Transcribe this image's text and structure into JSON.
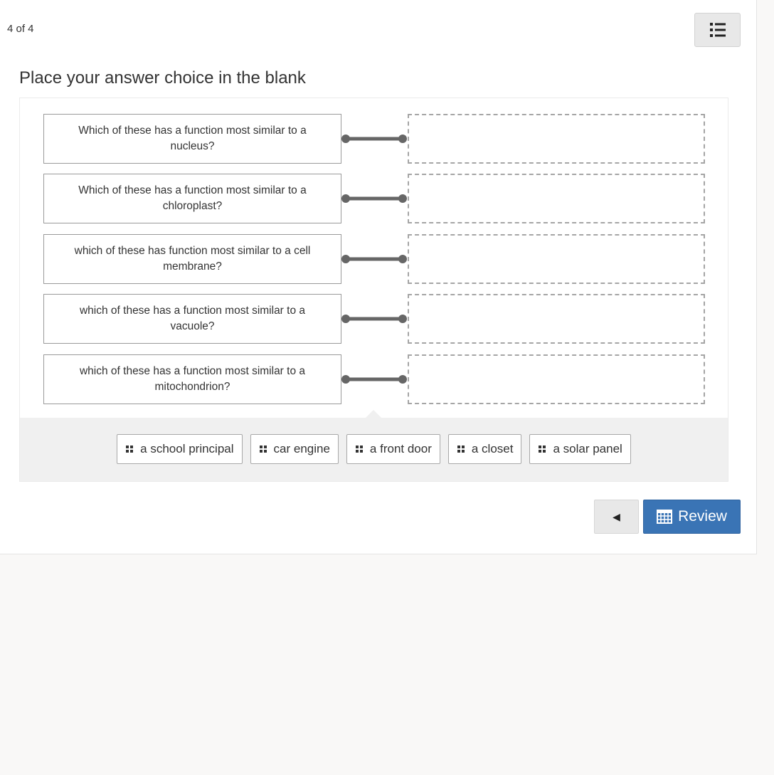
{
  "header": {
    "progress_text": "4 of 4",
    "menu_icon": "list-icon"
  },
  "question": {
    "prompt": "Place your answer choice in the blank"
  },
  "matches": [
    {
      "stem": "Which of these has a function most similar to a nucleus?",
      "answer": ""
    },
    {
      "stem": "Which of these has a function most similar to a chloroplast?",
      "answer": ""
    },
    {
      "stem": "which of these has function most similar to a cell membrane?",
      "answer": ""
    },
    {
      "stem": "which of these has a function most similar to a vacuole?",
      "answer": ""
    },
    {
      "stem": "which of these has a function most similar to a mitochondrion?",
      "answer": ""
    }
  ],
  "choices": [
    {
      "label": "a school principal"
    },
    {
      "label": "car engine"
    },
    {
      "label": "a front door"
    },
    {
      "label": "a closet"
    },
    {
      "label": "a solar panel"
    }
  ],
  "footer": {
    "back_icon": "triangle-left-icon",
    "back_glyph": "◀",
    "review_icon": "calendar-icon",
    "review_label": "Review"
  },
  "colors": {
    "primary": "#3a74b5",
    "connector": "#666666",
    "dashed_border": "#a5a5a5",
    "bank_background": "#f0f0f0"
  }
}
